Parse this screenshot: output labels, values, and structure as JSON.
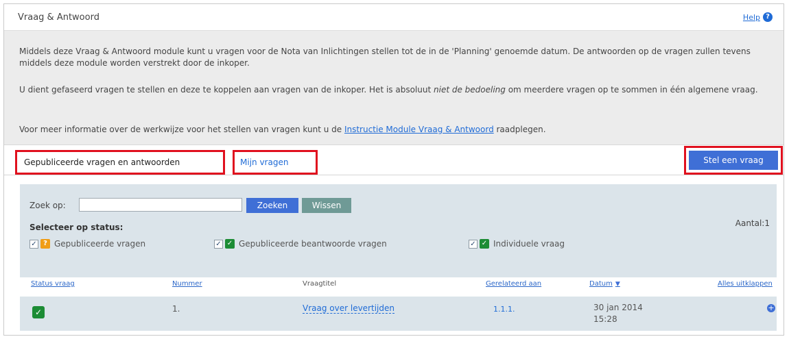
{
  "header": {
    "title": "Vraag & Antwoord",
    "help_label": "Help",
    "help_icon": "question-circle-icon"
  },
  "intro": {
    "p1": "Middels deze Vraag & Antwoord module kunt u vragen voor de Nota van Inlichtingen stellen tot de in de 'Planning' genoemde datum. De antwoorden op de vragen zullen tevens middels deze module worden verstrekt door de inkoper.",
    "p2_a": "U dient gefaseerd vragen te stellen en deze te koppelen aan vragen van de inkoper. Het is absoluut ",
    "p2_em": "niet de bedoeling",
    "p2_b": " om meerdere vragen op te sommen in één algemene vraag.",
    "p3_a": "Voor meer informatie over de werkwijze voor het stellen van vragen kunt u de ",
    "p3_link": "Instructie Module Vraag & Antwoord",
    "p3_b": " raadplegen."
  },
  "tabs": {
    "published": "Gepubliceerde vragen en antwoorden",
    "mine": "Mijn vragen"
  },
  "ask_button": "Stel een vraag",
  "filter": {
    "search_label": "Zoek op:",
    "search_value": "",
    "search_button": "Zoeken",
    "clear_button": "Wissen",
    "status_label": "Selecteer op status:",
    "count_label": "Aantal:1",
    "options": [
      {
        "label": "Gepubliceerde vragen",
        "checked": true,
        "icon": "question-icon",
        "color": "#f09d16"
      },
      {
        "label": "Gepubliceerde beantwoorde vragen",
        "checked": true,
        "icon": "answered-check-icon",
        "color": "#1c8c35"
      },
      {
        "label": "Individuele vraag",
        "checked": true,
        "icon": "answered-check-icon",
        "color": "#1c8c35"
      }
    ]
  },
  "table": {
    "headers": {
      "status": "Status vraag",
      "nummer": "Nummer",
      "titel": "Vraagtitel",
      "gerelateerd": "Gerelateerd aan",
      "datum": "Datum",
      "alles": "Alles uitklappen"
    },
    "rows": [
      {
        "status_icon": "answered-check-icon",
        "nummer": "1.",
        "titel": "Vraag over levertijden",
        "gerelateerd": "1.1.1.",
        "datum_line1": "30 jan 2014",
        "datum_line2": "15:28"
      }
    ]
  },
  "colors": {
    "accent": "#3f6fd6",
    "highlight_border": "#e0101e",
    "clear_button": "#6f9a96",
    "panel": "#dbe4ea"
  }
}
